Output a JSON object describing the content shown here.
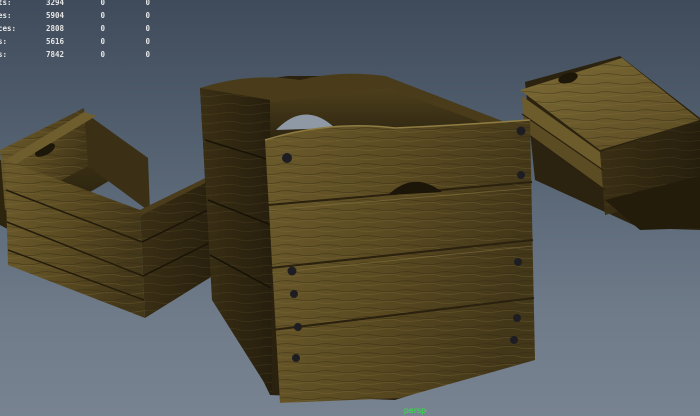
{
  "hud": {
    "rows": [
      {
        "label": "ts:",
        "v1": "3294",
        "v2": "0",
        "v3": "0"
      },
      {
        "label": "es:",
        "v1": "5904",
        "v2": "0",
        "v3": "0"
      },
      {
        "label": "ces:",
        "v1": "2808",
        "v2": "0",
        "v3": "0"
      },
      {
        "label": "s:",
        "v1": "5616",
        "v2": "0",
        "v3": "0"
      },
      {
        "label": "s:",
        "v1": "7842",
        "v2": "0",
        "v3": "0"
      }
    ]
  },
  "camera_label": "persp",
  "colors": {
    "hud_text": "#e6e6e6",
    "camera_label": "#2eea3e",
    "background_top": "#3f4b5a",
    "background_bottom": "#788391",
    "wood_dark": "#2b220f",
    "wood_mid": "#5a4a22",
    "wood_light": "#7b6a34"
  }
}
